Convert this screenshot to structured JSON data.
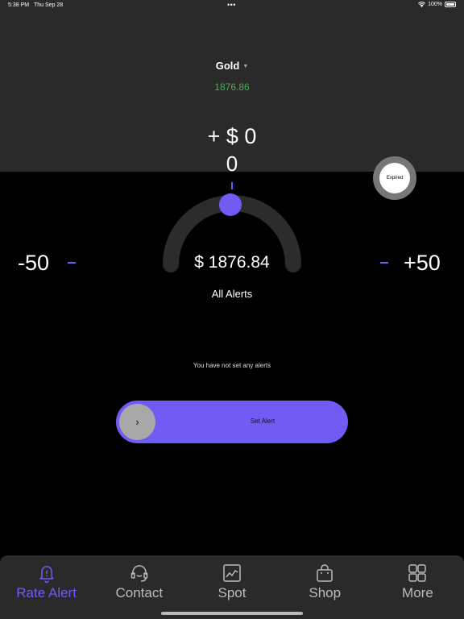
{
  "status_bar": {
    "time": "5:38 PM",
    "date": "Thu Sep 28",
    "dots": "•••",
    "battery": "100%"
  },
  "metal": {
    "name": "Gold",
    "price": "1876.86"
  },
  "delta": {
    "line": "+ $ 0",
    "value": "0"
  },
  "expired": {
    "label": "Expired"
  },
  "gauge": {
    "price": "$ 1876.84"
  },
  "adjust": {
    "minus_label": "-50",
    "plus_label": "+50"
  },
  "alerts": {
    "title": "All Alerts",
    "empty_message": "You have not set any alerts"
  },
  "set_alert": {
    "label": "Set Alert",
    "knob": "›"
  },
  "tabs": [
    {
      "label": "Rate Alert",
      "icon": "bell-icon",
      "active": true
    },
    {
      "label": "Contact",
      "icon": "headset-icon",
      "active": false
    },
    {
      "label": "Spot",
      "icon": "chart-icon",
      "active": false
    },
    {
      "label": "Shop",
      "icon": "bag-icon",
      "active": false
    },
    {
      "label": "More",
      "icon": "grid-icon",
      "active": false
    }
  ],
  "colors": {
    "accent": "#6e5cf5",
    "price_green": "#4caf50",
    "panel": "#2a2a2a",
    "background": "#000000"
  }
}
